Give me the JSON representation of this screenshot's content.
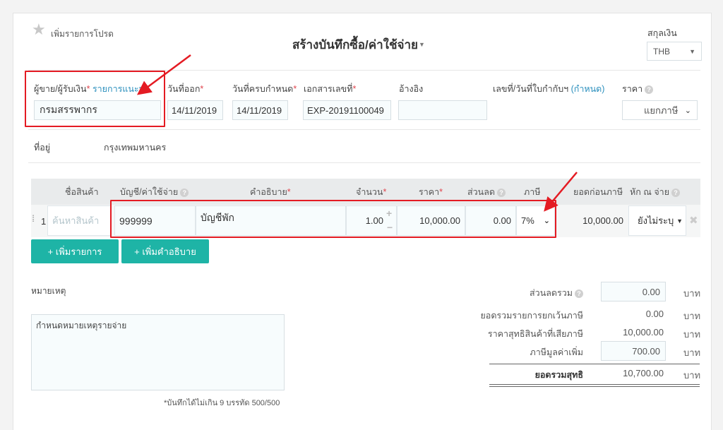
{
  "header": {
    "favorite_label": "เพิ่มรายการโปรด",
    "title": "สร้างบันทึกซื้อ/ค่าใช้จ่าย",
    "currency_label": "สกุลเงิน",
    "currency_value": "THB"
  },
  "form": {
    "vendor_label": "ผู้ขาย/ผู้รับเงิน",
    "vendor_recommend": "รายการแนะนำ",
    "vendor_value": "กรมสรรพากร",
    "issue_date_label": "วันที่ออก",
    "issue_date_value": "14/11/2019",
    "due_date_label": "วันที่ครบกำหนด",
    "due_date_value": "14/11/2019",
    "doc_no_label": "เอกสารเลขที่",
    "doc_no_value": "EXP-20191100049",
    "reference_label": "อ้างอิง",
    "reference_value": "",
    "tax_invoice_label": "เลขที่/วันที่ใบกำกับฯ",
    "tax_invoice_link": "(กำหนด)",
    "price_label": "ราคา",
    "price_type_value": "แยกภาษี",
    "address_label": "ที่อยู่",
    "address_value": "กรุงเทพมหานคร"
  },
  "table": {
    "headers": {
      "product": "ชื่อสินค้า",
      "account": "บัญชี/ค่าใช้จ่าย",
      "description": "คำอธิบาย",
      "quantity": "จำนวน",
      "price": "ราคา",
      "discount": "ส่วนลด",
      "tax": "ภาษี",
      "pretax": "ยอดก่อนภาษี",
      "withholding": "หัก ณ จ่าย"
    },
    "row": {
      "index": "1",
      "product_placeholder": "ค้นหาสินค้า",
      "account": "999999",
      "description": "บัญชีพัก",
      "quantity": "1.00",
      "price": "10,000.00",
      "discount": "0.00",
      "tax": "7%",
      "pretax": "10,000.00",
      "withholding": "ยังไม่ระบุ"
    },
    "add_item_label": "+ เพิ่มรายการ",
    "add_desc_label": "+ เพิ่มคำอธิบาย"
  },
  "notes": {
    "label": "หมายเหตุ",
    "placeholder": "กำหนดหมายเหตุรายจ่าย",
    "limit_text": "*บันทึกได้ไม่เกิน 9 บรรทัด 500/500"
  },
  "summary": {
    "currency_unit": "บาท",
    "total_discount_label": "ส่วนลดรวม",
    "total_discount_value": "0.00",
    "non_taxable_label": "ยอดรวมรายการยกเว้นภาษี",
    "non_taxable_value": "0.00",
    "taxable_net_label": "ราคาสุทธิสินค้าที่เสียภาษี",
    "taxable_net_value": "10,000.00",
    "vat_label": "ภาษีมูลค่าเพิ่ม",
    "vat_value": "700.00",
    "grand_total_label": "ยอดรวมสุทธิ",
    "grand_total_value": "10,700.00"
  },
  "colors": {
    "accent": "#1eb4a6",
    "annotation": "#e41b23",
    "link": "#2a8fbd",
    "required": "#e0464e"
  }
}
